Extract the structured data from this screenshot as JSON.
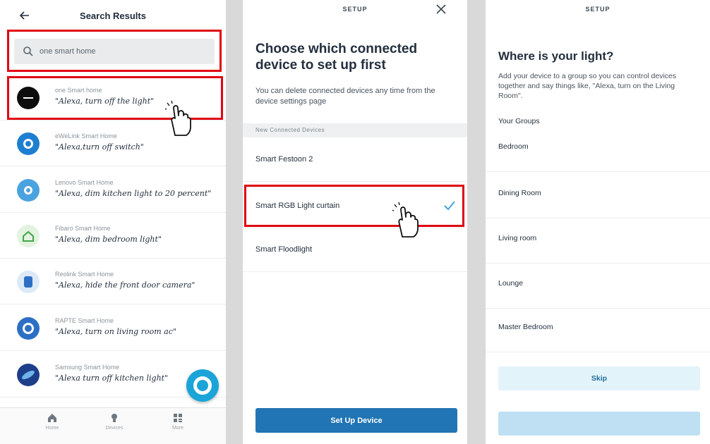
{
  "panel1": {
    "header": {
      "title": "Search Results"
    },
    "search": {
      "value": "one smart home"
    },
    "results": [
      {
        "name": "one Smart home",
        "phrase": "\"Alexa, turn off the light\""
      },
      {
        "name": "eWeLink Smart Home",
        "phrase": "\"Alexa,turn off switch\""
      },
      {
        "name": "Lenovo Smart Home",
        "phrase": "\"Alexa, dim kitchen light to 20 percent\""
      },
      {
        "name": "Fibaro Smart Home",
        "phrase": "\"Alexa, dim bedroom light\""
      },
      {
        "name": "Reolink Smart Home",
        "phrase": "\"Alexa, hide the front door camera\""
      },
      {
        "name": "RAPTE Smart Home",
        "phrase": "\"Alexa, turn on living room ac\""
      },
      {
        "name": "Samsung Smart Home",
        "phrase": "\"Alexa turn off kitchen light\""
      }
    ],
    "nav": [
      {
        "label": "Home",
        "icon": "home-icon"
      },
      {
        "label": "Devices",
        "icon": "lightbulb-icon"
      },
      {
        "label": "More",
        "icon": "grid-icon"
      }
    ]
  },
  "panel2": {
    "header": {
      "title": "SETUP"
    },
    "heading": "Choose which connected device to set up first",
    "subtext": "You can delete connected devices any time from the device settings page",
    "section_label": "New Connected Devices",
    "devices": [
      {
        "name": "Smart Festoon 2"
      },
      {
        "name": "Smart RGB Light curtain",
        "selected": true
      },
      {
        "name": "Smart Floodlight"
      }
    ],
    "primary_button": "Set Up Device"
  },
  "panel3": {
    "header": {
      "title": "SETUP"
    },
    "heading": "Where is your light?",
    "subtext": "Add your device to a group so you can control devices together and say things like, \"Alexa, turn on the Living Room\".",
    "groups_label": "Your Groups",
    "groups": [
      {
        "name": "Bedroom"
      },
      {
        "name": "Dining Room"
      },
      {
        "name": "Living room"
      },
      {
        "name": "Lounge"
      },
      {
        "name": "Master Bedroom"
      }
    ],
    "skip_button": "Skip"
  },
  "colors": {
    "highlight": "#e0050f",
    "primary": "#2275b4",
    "alexa_blue": "#1aa4d8",
    "check": "#43a6d8"
  }
}
